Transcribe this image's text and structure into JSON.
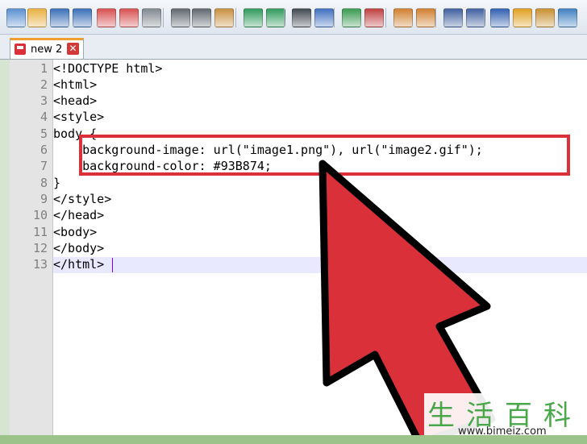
{
  "toolbar": {
    "icons": [
      "new-file-icon",
      "open-file-icon",
      "save-icon",
      "save-all-icon",
      "close-icon",
      "close-all-icon",
      "print-icon",
      "cut-icon",
      "copy-icon",
      "paste-icon",
      "undo-icon",
      "redo-icon",
      "find-icon",
      "replace-icon",
      "zoom-in-icon",
      "zoom-out-icon",
      "sync-vertical-icon",
      "sync-horizontal-icon",
      "word-wrap-icon",
      "show-all-chars-icon",
      "indent-guide-icon",
      "doc-map-icon",
      "function-list-icon",
      "folder-workspace-icon"
    ]
  },
  "tab": {
    "label": "new 2",
    "close": "✕"
  },
  "editor": {
    "line_numbers": [
      "1",
      "2",
      "3",
      "4",
      "5",
      "6",
      "7",
      "8",
      "9",
      "10",
      "11",
      "12",
      "13"
    ],
    "lines": [
      "<!DOCTYPE html>",
      "<html>",
      "<head>",
      "<style>",
      "body {",
      "    background-image: url(\"image1.png\"), url(\"image2.gif\");",
      "    background-color: #93B874;",
      "}",
      "</style>",
      "</head>",
      "<body>",
      "</body>",
      "</html>"
    ]
  },
  "watermark": {
    "chars": "生活百科",
    "url": "www.bimeiz.com"
  },
  "colors": {
    "highlight": "#d9303a",
    "arrow": "#d9303a",
    "accent_tab": "#f0a030",
    "current_line": "#e8e8ff"
  }
}
